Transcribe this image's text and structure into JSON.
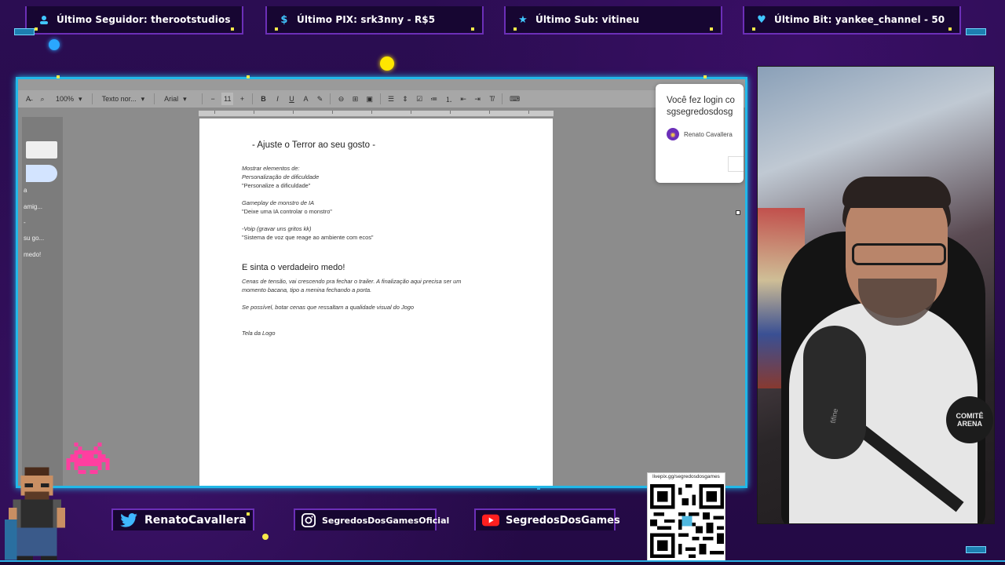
{
  "alerts": {
    "follower": "Último Seguidor: therootstudios",
    "pix": "Último PIX: srk3nny - R$5",
    "sub": "Último Sub: vitineu",
    "bit": "Último Bit: yankee_channel - 50"
  },
  "toolbar": {
    "zoom": "100%",
    "style": "Texto nor...",
    "font": "Arial",
    "font_size": "11"
  },
  "sidebar": {
    "items": [
      "a",
      "amig...",
      "-",
      "su go...",
      "medo!"
    ]
  },
  "document": {
    "heading1": "-  Ajuste o Terror ao seu gosto -",
    "lines": [
      "Mostrar elementos de:",
      " Personalização de dificuldade",
      "\"Personalize a dificuldade\"",
      " Gameplay de monstro de IA",
      "\"Deixe uma IA controlar o monstro\"",
      "-Voip (gravar uns gritos kk)",
      "\"Sistema de voz que reage ao ambiente com ecos\""
    ],
    "heading2": "E sinta o verdadeiro medo!",
    "para1_l1": "Cenas de tensão, vai crescendo pra fechar o trailer. A finalização aqui precisa ser um",
    "para1_l2": "momento bacana, tipo a menina fechando a porta.",
    "para2": "Se possível, botar cenas que ressaltam a qualidade visual do Jogo",
    "para3": "Tela da Logo"
  },
  "login_popup": {
    "title_l1": "Você fez login co",
    "title_l2": "sgsegredosdosg",
    "user": "Renato Cavallera"
  },
  "webcam": {
    "badge": "COMITÊ ARENA",
    "mic_brand": "fifine"
  },
  "socials": {
    "twitter": "RenatoCavallera",
    "instagram": "SegredosDosGamesOficial",
    "youtube": "SegredosDosGames"
  },
  "qr": {
    "label": "livepix.gg/segredosdosgames"
  },
  "colors": {
    "accent_purple": "#6c2fb8",
    "accent_cyan": "#22b8e8",
    "alert_yellow": "#f6e94a",
    "background": "#2a0c4e"
  }
}
